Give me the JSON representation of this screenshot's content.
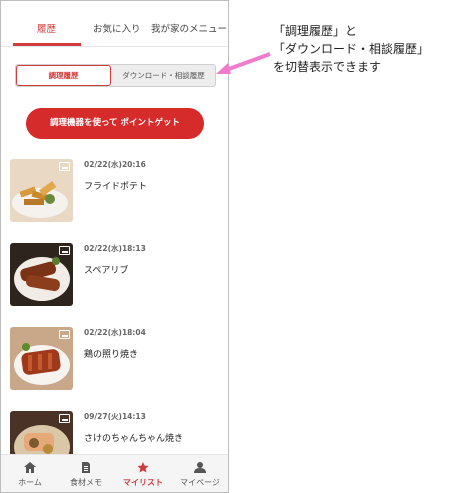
{
  "top_tabs": [
    {
      "label": "履歴"
    },
    {
      "label": "お気に入り"
    },
    {
      "label": "我が家のメニュー"
    }
  ],
  "segment": {
    "active": "調理履歴",
    "inactive": "ダウンロード・相談履歴"
  },
  "cta": {
    "label": "調理機器を使って ポイントゲット"
  },
  "history": [
    {
      "time": "02/22(水)20:16",
      "title": "フライドポテト"
    },
    {
      "time": "02/22(水)18:13",
      "title": "スペアリブ"
    },
    {
      "time": "02/22(水)18:04",
      "title": "鶏の照り焼き"
    },
    {
      "time": "09/27(火)14:13",
      "title": "さけのちゃんちゃん焼き"
    }
  ],
  "bottom_nav": [
    {
      "label": "ホーム",
      "icon": "home-icon"
    },
    {
      "label": "食材メモ",
      "icon": "memo-icon"
    },
    {
      "label": "マイリスト",
      "icon": "star-icon"
    },
    {
      "label": "マイページ",
      "icon": "person-icon"
    }
  ],
  "annotation": {
    "line1": "「調理履歴」と",
    "line2": "「ダウンロード・相談履歴」",
    "line3": "を切替表示できます"
  },
  "colors": {
    "accent": "#d23b3b",
    "cta": "#d52b2b",
    "arrow": "#f07acb"
  }
}
